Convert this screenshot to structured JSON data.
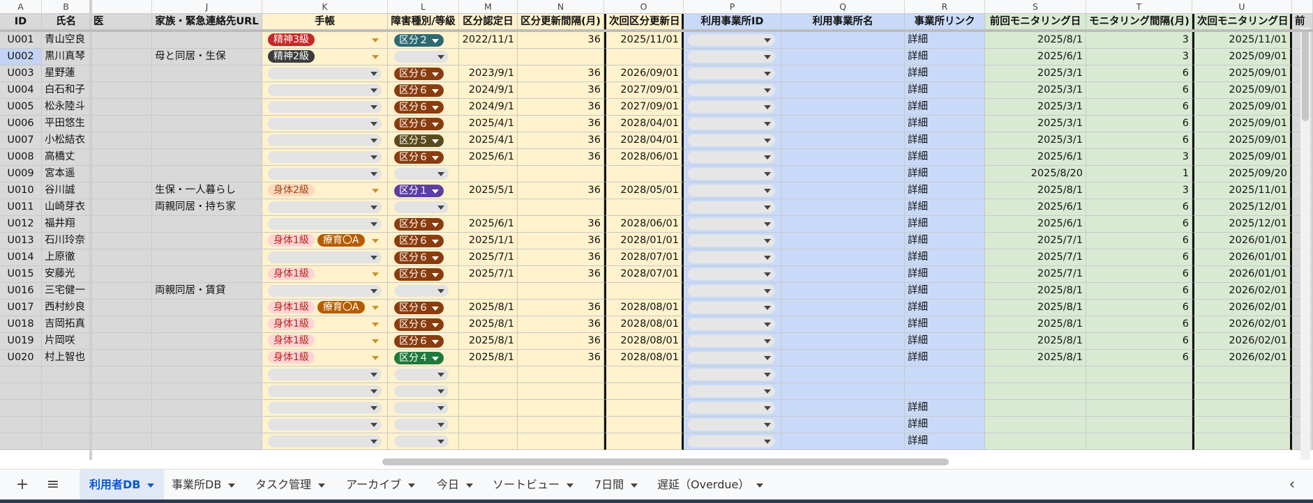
{
  "sheet": {
    "column_letters": [
      "A",
      "B",
      "",
      "J",
      "K",
      "L",
      "M",
      "N",
      "O",
      "P",
      "Q",
      "R",
      "S",
      "T",
      "U",
      ""
    ],
    "headers": {
      "id": "ID",
      "name": "氏名",
      "partial": "医",
      "family": "家族・緊急連絡先URL",
      "techo": "手帳",
      "disability": "障害種別/等級",
      "cert_date": "区分認定日",
      "renew_interval": "区分更新間隔(月)",
      "next_renew": "次回区分更新日",
      "office_id": "利用事業所ID",
      "office_name": "利用事業所名",
      "office_link": "事業所リンク",
      "last_monitor": "前回モニタリング日",
      "monitor_interval": "モニタリング間隔(月)",
      "next_monitor": "次回モニタリング日",
      "partial_right": "前"
    },
    "rows": [
      {
        "id": "U001",
        "name": "青山空良",
        "family": "",
        "techo": [
          {
            "text": "精神3級",
            "style": "red"
          }
        ],
        "kubun": {
          "text": "区分２",
          "style": "teal"
        },
        "cert": "2022/11/1",
        "interval": "36",
        "next": "2025/11/01",
        "link": "詳細",
        "last_mon": "2025/8/1",
        "mon_int": "3",
        "next_mon": "2025/11/01"
      },
      {
        "id": "U002",
        "name": "黒川真琴",
        "family": "母と同居・生保",
        "techo": [
          {
            "text": "精神2級",
            "style": "dark"
          }
        ],
        "kubun": null,
        "cert": "",
        "interval": "",
        "next": "",
        "link": "詳細",
        "last_mon": "2025/6/1",
        "mon_int": "3",
        "next_mon": "2025/09/01"
      },
      {
        "id": "U003",
        "name": "星野蓮",
        "family": "",
        "techo": [],
        "kubun": {
          "text": "区分６",
          "style": "brown"
        },
        "cert": "2023/9/1",
        "interval": "36",
        "next": "2026/09/01",
        "link": "詳細",
        "last_mon": "2025/3/1",
        "mon_int": "6",
        "next_mon": "2025/09/01"
      },
      {
        "id": "U004",
        "name": "白石和子",
        "family": "",
        "techo": [],
        "kubun": {
          "text": "区分６",
          "style": "brown"
        },
        "cert": "2024/9/1",
        "interval": "36",
        "next": "2027/09/01",
        "link": "詳細",
        "last_mon": "2025/3/1",
        "mon_int": "6",
        "next_mon": "2025/09/01"
      },
      {
        "id": "U005",
        "name": "松永陸斗",
        "family": "",
        "techo": [],
        "kubun": {
          "text": "区分６",
          "style": "brown"
        },
        "cert": "2024/9/1",
        "interval": "36",
        "next": "2027/09/01",
        "link": "詳細",
        "last_mon": "2025/3/1",
        "mon_int": "6",
        "next_mon": "2025/09/01"
      },
      {
        "id": "U006",
        "name": "平田悠生",
        "family": "",
        "techo": [],
        "kubun": {
          "text": "区分６",
          "style": "brown"
        },
        "cert": "2025/4/1",
        "interval": "36",
        "next": "2028/04/01",
        "link": "詳細",
        "last_mon": "2025/3/1",
        "mon_int": "6",
        "next_mon": "2025/09/01"
      },
      {
        "id": "U007",
        "name": "小松結衣",
        "family": "",
        "techo": [],
        "kubun": {
          "text": "区分５",
          "style": "olive"
        },
        "cert": "2025/4/1",
        "interval": "36",
        "next": "2028/04/01",
        "link": "詳細",
        "last_mon": "2025/3/1",
        "mon_int": "6",
        "next_mon": "2025/09/01"
      },
      {
        "id": "U008",
        "name": "高橋丈",
        "family": "",
        "techo": [],
        "kubun": {
          "text": "区分６",
          "style": "brown"
        },
        "cert": "2025/6/1",
        "interval": "36",
        "next": "2028/06/01",
        "link": "詳細",
        "last_mon": "2025/6/1",
        "mon_int": "3",
        "next_mon": "2025/09/01"
      },
      {
        "id": "U009",
        "name": "宮本遥",
        "family": "",
        "techo": [],
        "kubun": null,
        "cert": "",
        "interval": "",
        "next": "",
        "link": "詳細",
        "last_mon": "2025/8/20",
        "mon_int": "1",
        "next_mon": "2025/09/20"
      },
      {
        "id": "U010",
        "name": "谷川誠",
        "family": "生保・一人暮らし",
        "techo": [
          {
            "text": "身体2級",
            "style": "peach"
          }
        ],
        "kubun": {
          "text": "区分１",
          "style": "purple"
        },
        "cert": "2025/5/1",
        "interval": "36",
        "next": "2028/05/01",
        "link": "詳細",
        "last_mon": "2025/8/1",
        "mon_int": "3",
        "next_mon": "2025/11/01"
      },
      {
        "id": "U011",
        "name": "山崎芽衣",
        "family": "両親同居・持ち家",
        "techo": [],
        "kubun": null,
        "cert": "",
        "interval": "",
        "next": "",
        "link": "詳細",
        "last_mon": "2025/6/1",
        "mon_int": "6",
        "next_mon": "2025/12/01"
      },
      {
        "id": "U012",
        "name": "福井翔",
        "family": "",
        "techo": [],
        "kubun": {
          "text": "区分６",
          "style": "brown"
        },
        "cert": "2025/6/1",
        "interval": "36",
        "next": "2028/06/01",
        "link": "詳細",
        "last_mon": "2025/6/1",
        "mon_int": "6",
        "next_mon": "2025/12/01"
      },
      {
        "id": "U013",
        "name": "石川玲奈",
        "family": "",
        "techo": [
          {
            "text": "身体1級",
            "style": "pink"
          },
          {
            "text": "療育〇A",
            "style": "amber"
          }
        ],
        "kubun": {
          "text": "区分６",
          "style": "brown"
        },
        "cert": "2025/1/1",
        "interval": "36",
        "next": "2028/01/01",
        "link": "詳細",
        "last_mon": "2025/7/1",
        "mon_int": "6",
        "next_mon": "2026/01/01"
      },
      {
        "id": "U014",
        "name": "上原徹",
        "family": "",
        "techo": [],
        "kubun": {
          "text": "区分６",
          "style": "brown"
        },
        "cert": "2025/7/1",
        "interval": "36",
        "next": "2028/07/01",
        "link": "詳細",
        "last_mon": "2025/7/1",
        "mon_int": "6",
        "next_mon": "2026/01/01"
      },
      {
        "id": "U015",
        "name": "安藤光",
        "family": "",
        "techo": [
          {
            "text": "身体1級",
            "style": "pink"
          }
        ],
        "kubun": {
          "text": "区分６",
          "style": "brown"
        },
        "cert": "2025/7/1",
        "interval": "36",
        "next": "2028/07/01",
        "link": "詳細",
        "last_mon": "2025/7/1",
        "mon_int": "6",
        "next_mon": "2026/01/01"
      },
      {
        "id": "U016",
        "name": "三宅健一",
        "family": "両親同居・賃貸",
        "techo": [],
        "kubun": null,
        "cert": "",
        "interval": "",
        "next": "",
        "link": "詳細",
        "last_mon": "2025/8/1",
        "mon_int": "6",
        "next_mon": "2026/02/01"
      },
      {
        "id": "U017",
        "name": "西村紗良",
        "family": "",
        "techo": [
          {
            "text": "身体1級",
            "style": "pink"
          },
          {
            "text": "療育〇A",
            "style": "amber"
          }
        ],
        "kubun": {
          "text": "区分６",
          "style": "brown"
        },
        "cert": "2025/8/1",
        "interval": "36",
        "next": "2028/08/01",
        "link": "詳細",
        "last_mon": "2025/8/1",
        "mon_int": "6",
        "next_mon": "2026/02/01"
      },
      {
        "id": "U018",
        "name": "吉岡拓真",
        "family": "",
        "techo": [
          {
            "text": "身体1級",
            "style": "pink"
          }
        ],
        "kubun": {
          "text": "区分６",
          "style": "brown"
        },
        "cert": "2025/8/1",
        "interval": "36",
        "next": "2028/08/01",
        "link": "詳細",
        "last_mon": "2025/8/1",
        "mon_int": "6",
        "next_mon": "2026/02/01"
      },
      {
        "id": "U019",
        "name": "片岡咲",
        "family": "",
        "techo": [
          {
            "text": "身体1級",
            "style": "pink"
          }
        ],
        "kubun": {
          "text": "区分６",
          "style": "brown"
        },
        "cert": "2025/8/1",
        "interval": "36",
        "next": "2028/08/01",
        "link": "詳細",
        "last_mon": "2025/8/1",
        "mon_int": "6",
        "next_mon": "2026/02/01"
      },
      {
        "id": "U020",
        "name": "村上智也",
        "family": "",
        "techo": [
          {
            "text": "身体1級",
            "style": "pink"
          }
        ],
        "kubun": {
          "text": "区分４",
          "style": "green"
        },
        "cert": "2025/8/1",
        "interval": "36",
        "next": "2028/08/01",
        "link": "詳細",
        "last_mon": "2025/8/1",
        "mon_int": "6",
        "next_mon": "2026/02/01"
      },
      {
        "id": "",
        "name": "",
        "family": "",
        "techo": [],
        "kubun": null,
        "cert": "",
        "interval": "",
        "next": "",
        "link": "",
        "last_mon": "",
        "mon_int": "",
        "next_mon": ""
      },
      {
        "id": "",
        "name": "",
        "family": "",
        "techo": [],
        "kubun": null,
        "cert": "",
        "interval": "",
        "next": "",
        "link": "",
        "last_mon": "",
        "mon_int": "",
        "next_mon": ""
      },
      {
        "id": "",
        "name": "",
        "family": "",
        "techo": [],
        "kubun": null,
        "cert": "",
        "interval": "",
        "next": "",
        "link": "詳細",
        "last_mon": "",
        "mon_int": "",
        "next_mon": ""
      },
      {
        "id": "",
        "name": "",
        "family": "",
        "techo": [],
        "kubun": null,
        "cert": "",
        "interval": "",
        "next": "",
        "link": "詳細",
        "last_mon": "",
        "mon_int": "",
        "next_mon": ""
      },
      {
        "id": "",
        "name": "",
        "family": "",
        "techo": [],
        "kubun": null,
        "cert": "",
        "interval": "",
        "next": "",
        "link": "詳細",
        "last_mon": "",
        "mon_int": "",
        "next_mon": ""
      }
    ]
  },
  "chip_colors": {
    "red": "#c62828",
    "dark": "#3c3c3c",
    "teal": "#2d6a73",
    "brown": "#8a3c0e",
    "olive": "#5a4a1c",
    "purple": "#5b3fa0",
    "green": "#1e7a3c",
    "peach": "#ffd9bf",
    "pink": "#ffd4d4",
    "amber": "#b65c00"
  },
  "sheet_tabs": {
    "add_icon": "plus-icon",
    "all_sheets_icon": "menu-icon",
    "tabs": [
      "利用者DB",
      "事業所DB",
      "タスク管理",
      "アーカイブ",
      "今日",
      "ソートビュー",
      "7日間",
      "遅延（Overdue）"
    ],
    "active_index": 0,
    "collapse_icon": "chevron-left-icon",
    "collapse_glyph": "‹"
  }
}
